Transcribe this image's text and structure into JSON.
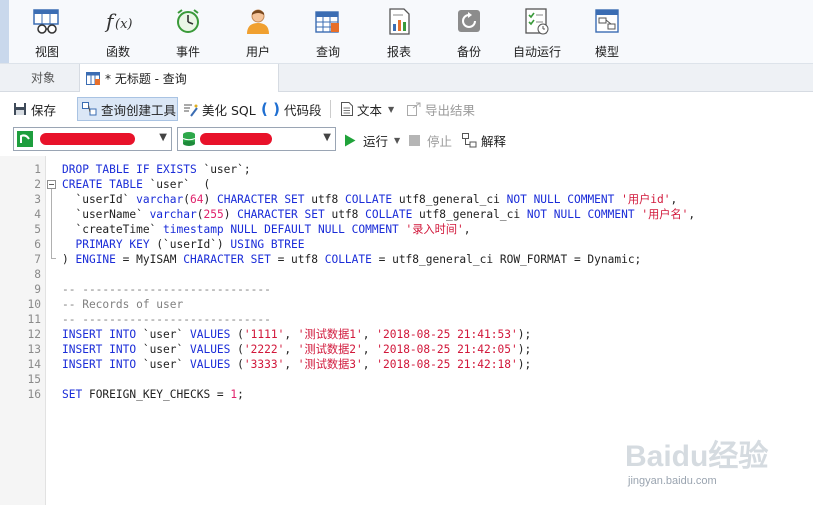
{
  "ribbon": {
    "items": [
      {
        "label": "视图",
        "icon": "view-icon"
      },
      {
        "label": "函数",
        "icon": "function-icon"
      },
      {
        "label": "事件",
        "icon": "event-clock-icon"
      },
      {
        "label": "用户",
        "icon": "user-icon"
      },
      {
        "label": "查询",
        "icon": "query-table-icon"
      },
      {
        "label": "报表",
        "icon": "report-icon"
      },
      {
        "label": "备份",
        "icon": "backup-icon"
      },
      {
        "label": "自动运行",
        "icon": "automation-icon"
      },
      {
        "label": "模型",
        "icon": "model-icon"
      }
    ]
  },
  "tabs": {
    "objects": "对象",
    "query": "* 无标题 - 查询"
  },
  "toolbar": {
    "save": "保存",
    "query_builder": "查询创建工具",
    "beautify": "美化 SQL",
    "code_snippet": "代码段",
    "text": "文本",
    "export": "导出结果",
    "run": "运行",
    "stop": "停止",
    "explain": "解释"
  },
  "editor": {
    "line_numbers": [
      "1",
      "2",
      "3",
      "4",
      "5",
      "6",
      "7",
      "8",
      "9",
      "10",
      "11",
      "12",
      "13",
      "14",
      "15",
      "16"
    ]
  },
  "watermark": {
    "brand": "Baidu经验",
    "url": "jingyan.baidu.com"
  },
  "colors": {
    "keyword": "#1a2cd8",
    "string": "#d1173a",
    "comment": "#808080",
    "number": "#e0206a",
    "redaction": "#e8122a"
  }
}
